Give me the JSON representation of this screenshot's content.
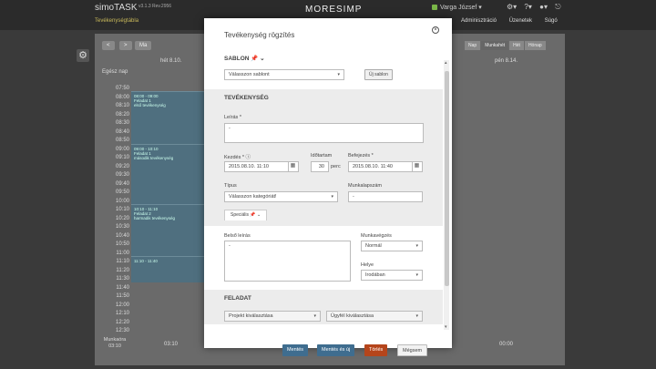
{
  "app": {
    "title": "simoTASK",
    "version": "v3.1.3 Rev.2956",
    "subtitle": "Tevékenységtábla"
  },
  "brand": "MORESIMP",
  "user": {
    "name": "Varga József ▾"
  },
  "top_icons": [
    "gear-icon",
    "help-icon",
    "user-icon",
    "logout-icon"
  ],
  "top_icon_glyphs": [
    "⚙▾",
    "?▾",
    "●▾",
    "⎋"
  ],
  "topnav": [
    "Adminisztráció",
    "Üzenetek",
    "Súgó"
  ],
  "calendar": {
    "nav": {
      "prev": "<",
      "next": ">",
      "today": "Ma"
    },
    "views": [
      "Nap",
      "Munkahét",
      "Hét",
      "Hónap"
    ],
    "active_view": "Munkahét",
    "days": [
      {
        "label": "hét 8.10."
      },
      {
        "label": "pén 8.14."
      }
    ],
    "allday": "Egész nap",
    "times": [
      "07:50",
      "08:00",
      "08:10",
      "08:20",
      "08:30",
      "08:40",
      "08:50",
      "09:00",
      "09:10",
      "09:20",
      "09:30",
      "09:40",
      "09:50",
      "10:00",
      "10:10",
      "10:20",
      "10:30",
      "10:40",
      "10:50",
      "11:00",
      "11:10",
      "11:20",
      "11:30",
      "11:40",
      "11:50",
      "12:00",
      "12:10",
      "12:20",
      "12:30"
    ],
    "events": [
      {
        "time": "08:00 - 09:00",
        "title": "Feladat 1",
        "desc": "első tevékenység"
      },
      {
        "time": "09:00 - 10:10",
        "title": "Feladat 1",
        "desc": "második tevékenység"
      },
      {
        "time": "10:10 - 11:10",
        "title": "Feladat 2",
        "desc": "harmadik tevékenység"
      },
      {
        "time": "11:10 - 11:40",
        "title": "",
        "desc": ""
      }
    ],
    "worktime_label": "Munkaóra 03:10",
    "worktime_values": [
      "03:10",
      "00:00"
    ]
  },
  "modal": {
    "title": "Tevékenység rögzítés",
    "close": "×",
    "template_section": "SABLON",
    "template_select": "Válasszon sablont",
    "new_template_button": "Új sablon",
    "activity_section": "TEVÉKENYSÉG",
    "description_label": "Leírás *",
    "description_value": "-",
    "start_label": "Kezdés *",
    "start_value": "2015.08.10. 11:10",
    "duration_label": "Időtartam",
    "duration_value": "30",
    "duration_unit": "perc",
    "end_label": "Befejezés *",
    "end_value": "2015.08.10. 11:40",
    "type_label": "Típus",
    "type_value": "Válasszon kategóriát!",
    "worksheet_label": "Munkalapszám",
    "worksheet_value": "-",
    "special_tab": "Speciális",
    "internal_desc_label": "Belső leírás",
    "internal_desc_value": "-",
    "work_mode_label": "Munkavégzés",
    "work_mode_value": "Normál",
    "location_label": "Helye",
    "location_value": "Irodában",
    "task_section": "FELADAT",
    "project_select": "Projekt kiválasztása",
    "client_select": "Ügyfél kiválasztása",
    "buttons": {
      "save": "Mentés",
      "save_new": "Mentés és új",
      "delete": "Törlés",
      "cancel": "Mégsem"
    },
    "colors": {
      "save": "#3f6d8f",
      "delete": "#b5451b"
    }
  }
}
